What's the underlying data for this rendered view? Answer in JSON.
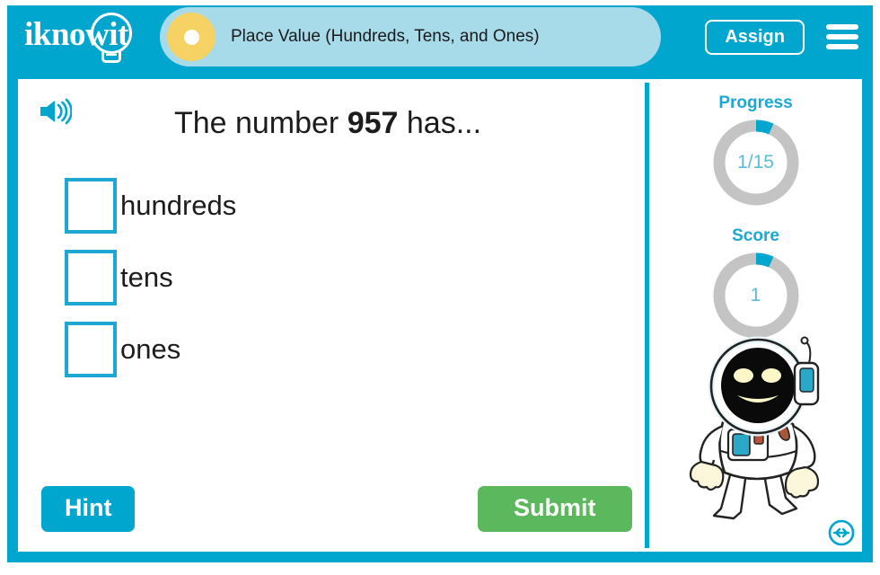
{
  "header": {
    "logo_text": "iknowit",
    "logo_icon": "lightbulb-icon",
    "title": "Place Value (Hundreds, Tens, and Ones)",
    "title_icon": "yellow-circle-icon",
    "assign_label": "Assign",
    "menu_icon": "hamburger-menu-icon",
    "bar_color": "#00a6ce",
    "title_bar_color": "#a7dbe9",
    "title_dot_color": "#f5d263"
  },
  "question": {
    "audio_icon": "speaker-icon",
    "prefix": "The number ",
    "number": "957",
    "suffix": " has...",
    "answers": [
      {
        "label": "hundreds",
        "value": "",
        "placeholder": ""
      },
      {
        "label": "tens",
        "value": "",
        "placeholder": ""
      },
      {
        "label": "ones",
        "value": "",
        "placeholder": ""
      }
    ]
  },
  "actions": {
    "hint_label": "Hint",
    "hint_color": "#00a6ce",
    "submit_label": "Submit",
    "submit_color": "#5cb85c"
  },
  "sidebar": {
    "progress": {
      "label": "Progress",
      "value": "1/15",
      "current": 1,
      "total": 15,
      "percent": 6.7,
      "arc_color": "#00a6ce",
      "track_color": "#c4c4c4"
    },
    "score": {
      "label": "Score",
      "value": "1",
      "percent": 6.7,
      "arc_color": "#00a6ce",
      "track_color": "#c4c4c4"
    },
    "mascot": "astronaut-mascot",
    "resize_icon": "resize-horizontal-icon"
  }
}
